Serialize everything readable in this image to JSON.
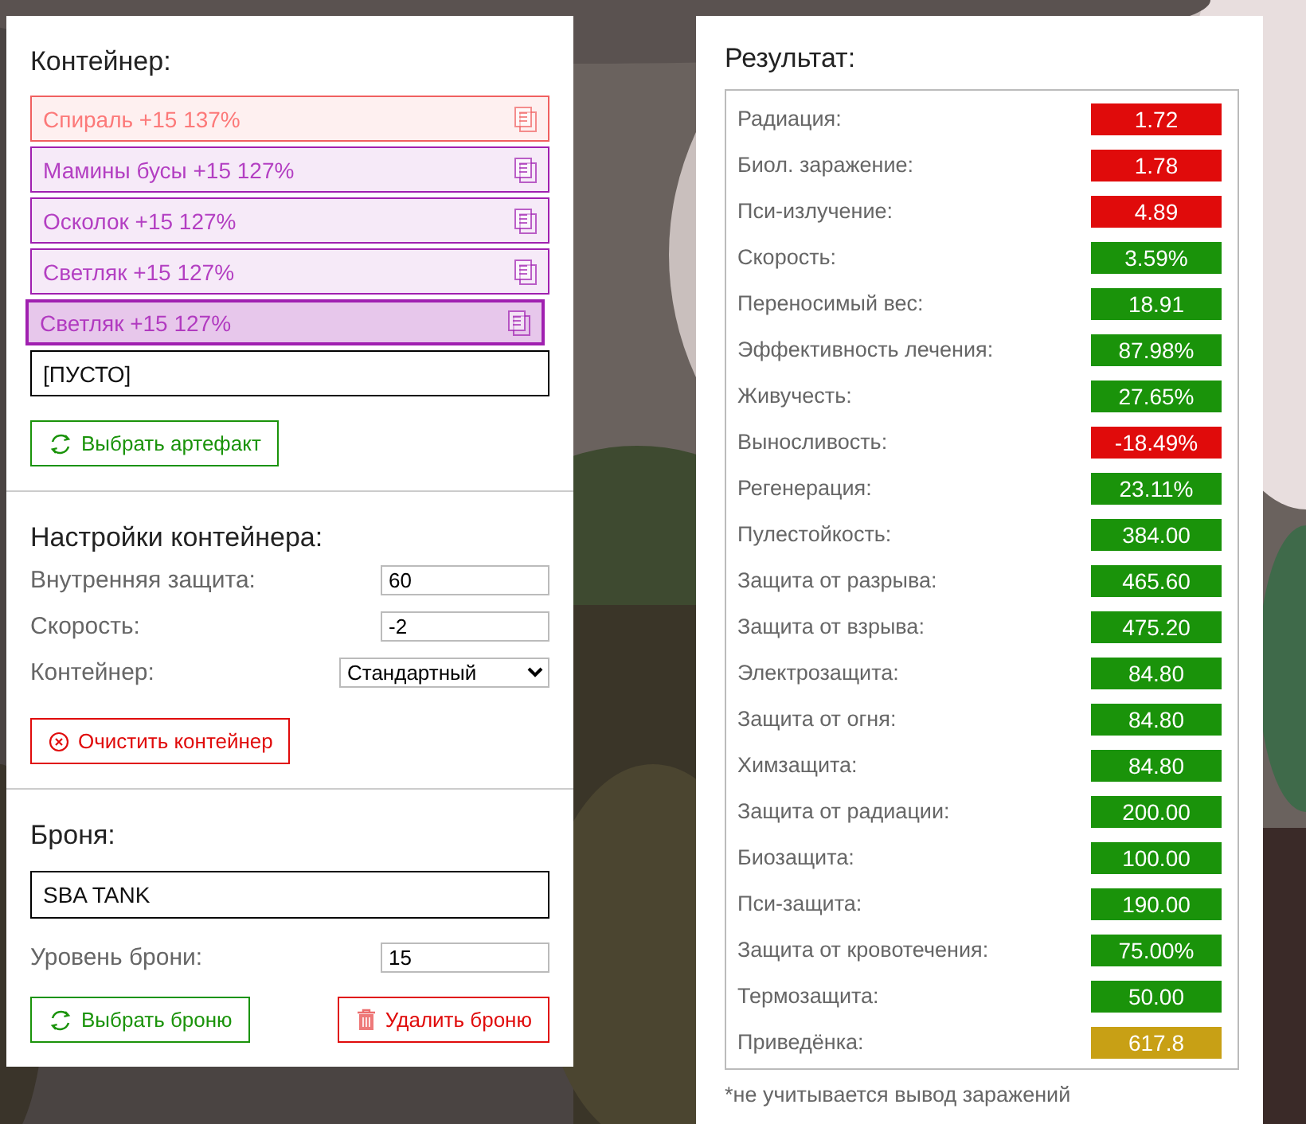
{
  "container": {
    "title": "Контейнер:",
    "slots": [
      {
        "kind": "artifact",
        "label": "Спираль +15 137%",
        "color": "#f06060",
        "selected": false
      },
      {
        "kind": "artifact",
        "label": "Мамины бусы +15 127%",
        "color": "#a020b0",
        "selected": false
      },
      {
        "kind": "artifact",
        "label": "Осколок +15 127%",
        "color": "#a020b0",
        "selected": false
      },
      {
        "kind": "artifact",
        "label": "Светляк +15 127%",
        "color": "#a020b0",
        "selected": false
      },
      {
        "kind": "artifact",
        "label": "Светляк +15 127%",
        "color": "#a020b0",
        "selected": true
      },
      {
        "kind": "empty",
        "label": "[ПУСТО]"
      }
    ],
    "button": {
      "kind": "select",
      "label": "Выбрать артефакт"
    }
  },
  "settings": {
    "title": "Настройки контейнера:",
    "fields": [
      {
        "kind": "input",
        "label": "Внутренняя защита:",
        "value": "60"
      },
      {
        "kind": "input",
        "label": "Скорость:",
        "value": "-2"
      },
      {
        "kind": "select",
        "label": "Контейнер:",
        "value": "Стандартный"
      }
    ],
    "button": {
      "kind": "clear",
      "label": "Очистить контейнер"
    }
  },
  "armor": {
    "title": "Броня:",
    "name": "SBA TANK",
    "level": {
      "label": "Уровень брони:",
      "value": "15"
    },
    "buttons": [
      {
        "kind": "select",
        "label": "Выбрать броню"
      },
      {
        "kind": "delete",
        "label": "Удалить броню"
      }
    ]
  },
  "result": {
    "title": "Результат:",
    "stats": [
      {
        "label": "Радиация:",
        "value": "1.72",
        "color": "#e00b0b"
      },
      {
        "label": "Биол. заражение:",
        "value": "1.78",
        "color": "#e00b0b"
      },
      {
        "label": "Пси-излучение:",
        "value": "4.89",
        "color": "#e00b0b"
      },
      {
        "label": "Скорость:",
        "value": "3.59%",
        "color": "#1a930a"
      },
      {
        "label": "Переносимый вес:",
        "value": "18.91",
        "color": "#1a930a"
      },
      {
        "label": "Эффективность лечения:",
        "value": "87.98%",
        "color": "#1a930a"
      },
      {
        "label": "Живучесть:",
        "value": "27.65%",
        "color": "#1a930a"
      },
      {
        "label": "Выносливость:",
        "value": "-18.49%",
        "color": "#e00b0b"
      },
      {
        "label": "Регенерация:",
        "value": "23.11%",
        "color": "#1a930a"
      },
      {
        "label": "Пулестойкость:",
        "value": "384.00",
        "color": "#1a930a"
      },
      {
        "label": "Защита от разрыва:",
        "value": "465.60",
        "color": "#1a930a"
      },
      {
        "label": "Защита от взрыва:",
        "value": "475.20",
        "color": "#1a930a"
      },
      {
        "label": "Электрозащита:",
        "value": "84.80",
        "color": "#1a930a"
      },
      {
        "label": "Защита от огня:",
        "value": "84.80",
        "color": "#1a930a"
      },
      {
        "label": "Химзащита:",
        "value": "84.80",
        "color": "#1a930a"
      },
      {
        "label": "Защита от радиации:",
        "value": "200.00",
        "color": "#1a930a"
      },
      {
        "label": "Биозащита:",
        "value": "100.00",
        "color": "#1a930a"
      },
      {
        "label": "Пси-защита:",
        "value": "190.00",
        "color": "#1a930a"
      },
      {
        "label": "Защита от кровотечения:",
        "value": "75.00%",
        "color": "#1a930a"
      },
      {
        "label": "Термозащита:",
        "value": "50.00",
        "color": "#1a930a"
      },
      {
        "label": "Приведёнка:",
        "value": "617.8",
        "color": "#c8a015"
      }
    ],
    "footnote": "*не учитывается вывод заражений"
  }
}
